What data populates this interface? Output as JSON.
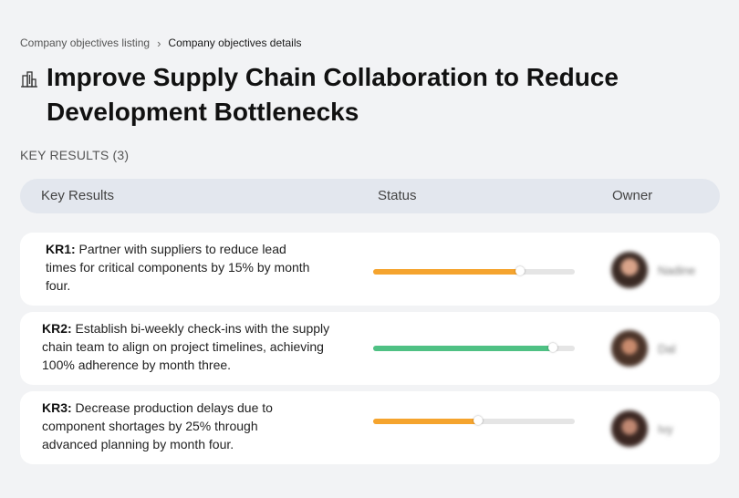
{
  "breadcrumb": {
    "parent": "Company objectives listing",
    "current": "Company objectives details"
  },
  "objective": {
    "title": "Improve Supply Chain Collaboration to Reduce Development Bottlenecks",
    "icon": "building-icon"
  },
  "key_results_heading": "KEY RESULTS (3)",
  "table": {
    "headers": {
      "key_results": "Key Results",
      "status": "Status",
      "owner": "Owner"
    },
    "rows": [
      {
        "id": "KR1:",
        "text": " Partner with suppliers to reduce lead times for critical components by 15% by month four.",
        "progress": 0.73,
        "status_color": "#f5a42e",
        "owner": "Nadine"
      },
      {
        "id": "KR2:",
        "text": " Establish bi-weekly check-ins with the supply chain team to align on project timelines, achieving 100% adherence by month three.",
        "progress": 0.89,
        "status_color": "#4fc184",
        "owner": "Dal"
      },
      {
        "id": "KR3:",
        "text": " Decrease production delays due to component shortages by 25% through advanced planning by month four.",
        "progress": 0.52,
        "status_color": "#f5a42e",
        "owner": "Ivy"
      }
    ]
  }
}
